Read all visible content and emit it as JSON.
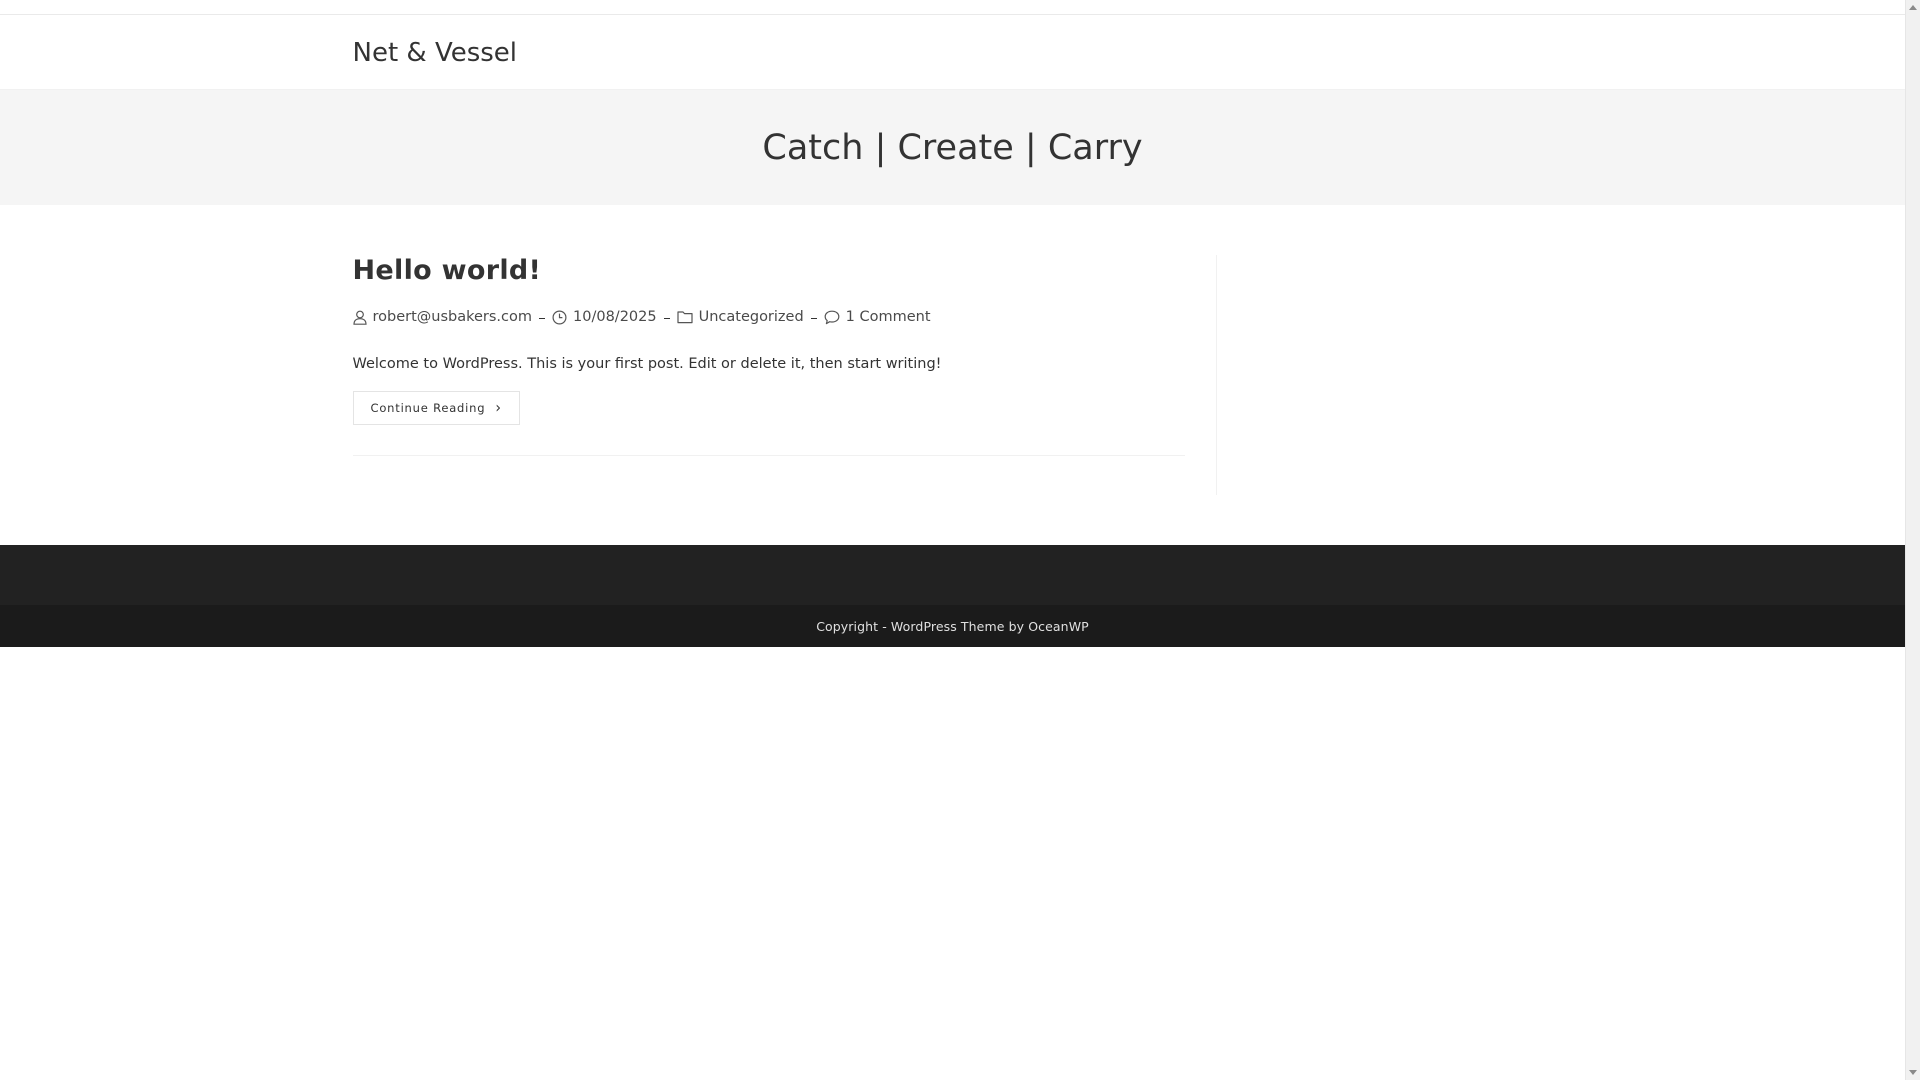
{
  "site": {
    "title": "Net & Vessel"
  },
  "page_header": {
    "title": "Catch | Create | Carry"
  },
  "post": {
    "title": "Hello world!",
    "meta": {
      "author": "robert@usbakers.com",
      "date": "10/08/2025",
      "category": "Uncategorized",
      "comments": "1 Comment"
    },
    "excerpt": "Welcome to WordPress. This is your first post. Edit or delete it, then start writing!",
    "continue_label": "Continue Reading",
    "continue_icon": "chevron-right-icon"
  },
  "footer": {
    "copyright": "Copyright - WordPress Theme by OceanWP"
  },
  "colors": {
    "page_header_bg": "#f5f5f5",
    "footer_widgets_bg": "#222222",
    "footer_bottom_bg": "#1b1b1b"
  }
}
